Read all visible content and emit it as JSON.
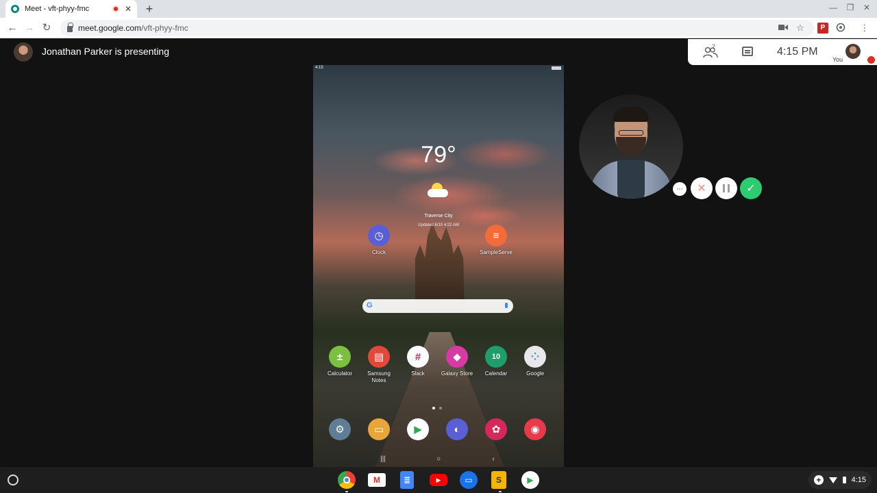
{
  "browser": {
    "tab_title": "Meet - vft-phyy-fmc",
    "tab_close": "✕",
    "new_tab": "+",
    "url_host": "meet.google.com",
    "url_path": "/vft-phyy-fmc",
    "window_minimize": "—",
    "window_restore": "❐",
    "window_close": "✕",
    "back": "←",
    "forward": "→",
    "reload": "↻",
    "bookmark_star": "☆",
    "menu": "⋮"
  },
  "meet": {
    "presenter_text": "Jonathan Parker is presenting",
    "people_count": "2",
    "clock": "4:15 PM",
    "self_label": "You",
    "controls": {
      "more": "⋯",
      "stop": "✕",
      "pause": "",
      "done": "✓"
    }
  },
  "tablet": {
    "status_time": "4:15",
    "weather_temp": "79°",
    "weather_city": "Traverse City",
    "weather_updated": "Updated 6/10 4:22 AM",
    "apps_top": [
      {
        "label": "Clock",
        "color": "#5b5fd6",
        "glyph": "◷"
      },
      {
        "label": "SampleServe",
        "color": "#f26b3a",
        "glyph": "≡"
      }
    ],
    "apps_row": [
      {
        "label": "Calculator",
        "color": "#7bc043",
        "glyph": "±"
      },
      {
        "label": "Samsung Notes",
        "color": "#e0493a",
        "glyph": "▤"
      },
      {
        "label": "Slack",
        "color": "#ffffff",
        "glyph": "#"
      },
      {
        "label": "Galaxy Store",
        "color": "#d63aa5",
        "glyph": "◆"
      },
      {
        "label": "Calendar",
        "color": "#1f9d6b",
        "glyph": "10"
      },
      {
        "label": "Google",
        "color": "#e8e8e8",
        "glyph": "⁘"
      }
    ],
    "dock": [
      {
        "label": "Settings",
        "color": "#5f7d95",
        "glyph": "⚙"
      },
      {
        "label": "My Files",
        "color": "#e8a53a",
        "glyph": "▭"
      },
      {
        "label": "Play Store",
        "color": "#ffffff",
        "glyph": "▶"
      },
      {
        "label": "Internet",
        "color": "#5b5fd6",
        "glyph": "◐"
      },
      {
        "label": "Gallery",
        "color": "#d6285a",
        "glyph": "✿"
      },
      {
        "label": "Camera",
        "color": "#e83a4a",
        "glyph": "◉"
      }
    ],
    "nav": {
      "recents": "|||",
      "home": "○",
      "back": "‹"
    }
  },
  "shelf": {
    "apps": [
      {
        "name": "chrome",
        "color": "#4caf50",
        "glyph": "◎"
      },
      {
        "name": "gmail",
        "color": "#d93025",
        "glyph": "M"
      },
      {
        "name": "docs",
        "color": "#4285f4",
        "glyph": "≣"
      },
      {
        "name": "youtube",
        "color": "#ff0000",
        "glyph": "▶"
      },
      {
        "name": "files",
        "color": "#1a73e8",
        "glyph": "▭"
      },
      {
        "name": "slides",
        "color": "#f4b400",
        "glyph": "S"
      },
      {
        "name": "play-store",
        "color": "#ffffff",
        "glyph": "▶"
      }
    ],
    "tray_time": "4:15",
    "tray_plus": "+"
  }
}
